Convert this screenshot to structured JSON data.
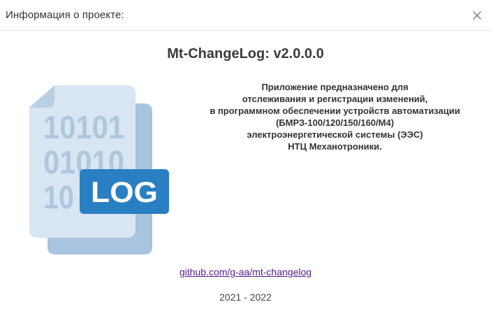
{
  "dialog": {
    "title": "Информация о проекте:",
    "close_icon": "close-icon"
  },
  "app": {
    "title": "Mt-ChangeLog: v2.0.0.0",
    "logo_icon": "log-file-icon",
    "logo_text": "LOG",
    "logo_binary_rows": [
      "10101",
      "01010",
      "10"
    ]
  },
  "description": {
    "lines": [
      "Приложение предназначено для",
      "отслеживания и регистрации изменений,",
      "в программном обеспечении устройств автоматизации",
      "(БМРЗ-100/120/150/160/М4)",
      "электроэнергетической системы (ЭЭС)",
      "НТЦ Механотроники."
    ]
  },
  "link": {
    "text": "github.com/g-aa/mt-changelog"
  },
  "footer": {
    "years": "2021 - 2022"
  },
  "colors": {
    "logo_back_page": "#a9c4df",
    "logo_front_page": "#d8e5f2",
    "logo_digits": "#aec7de",
    "logo_badge": "#2a7fc2",
    "logo_badge_text": "#ffffff",
    "link": "#551a8b"
  }
}
